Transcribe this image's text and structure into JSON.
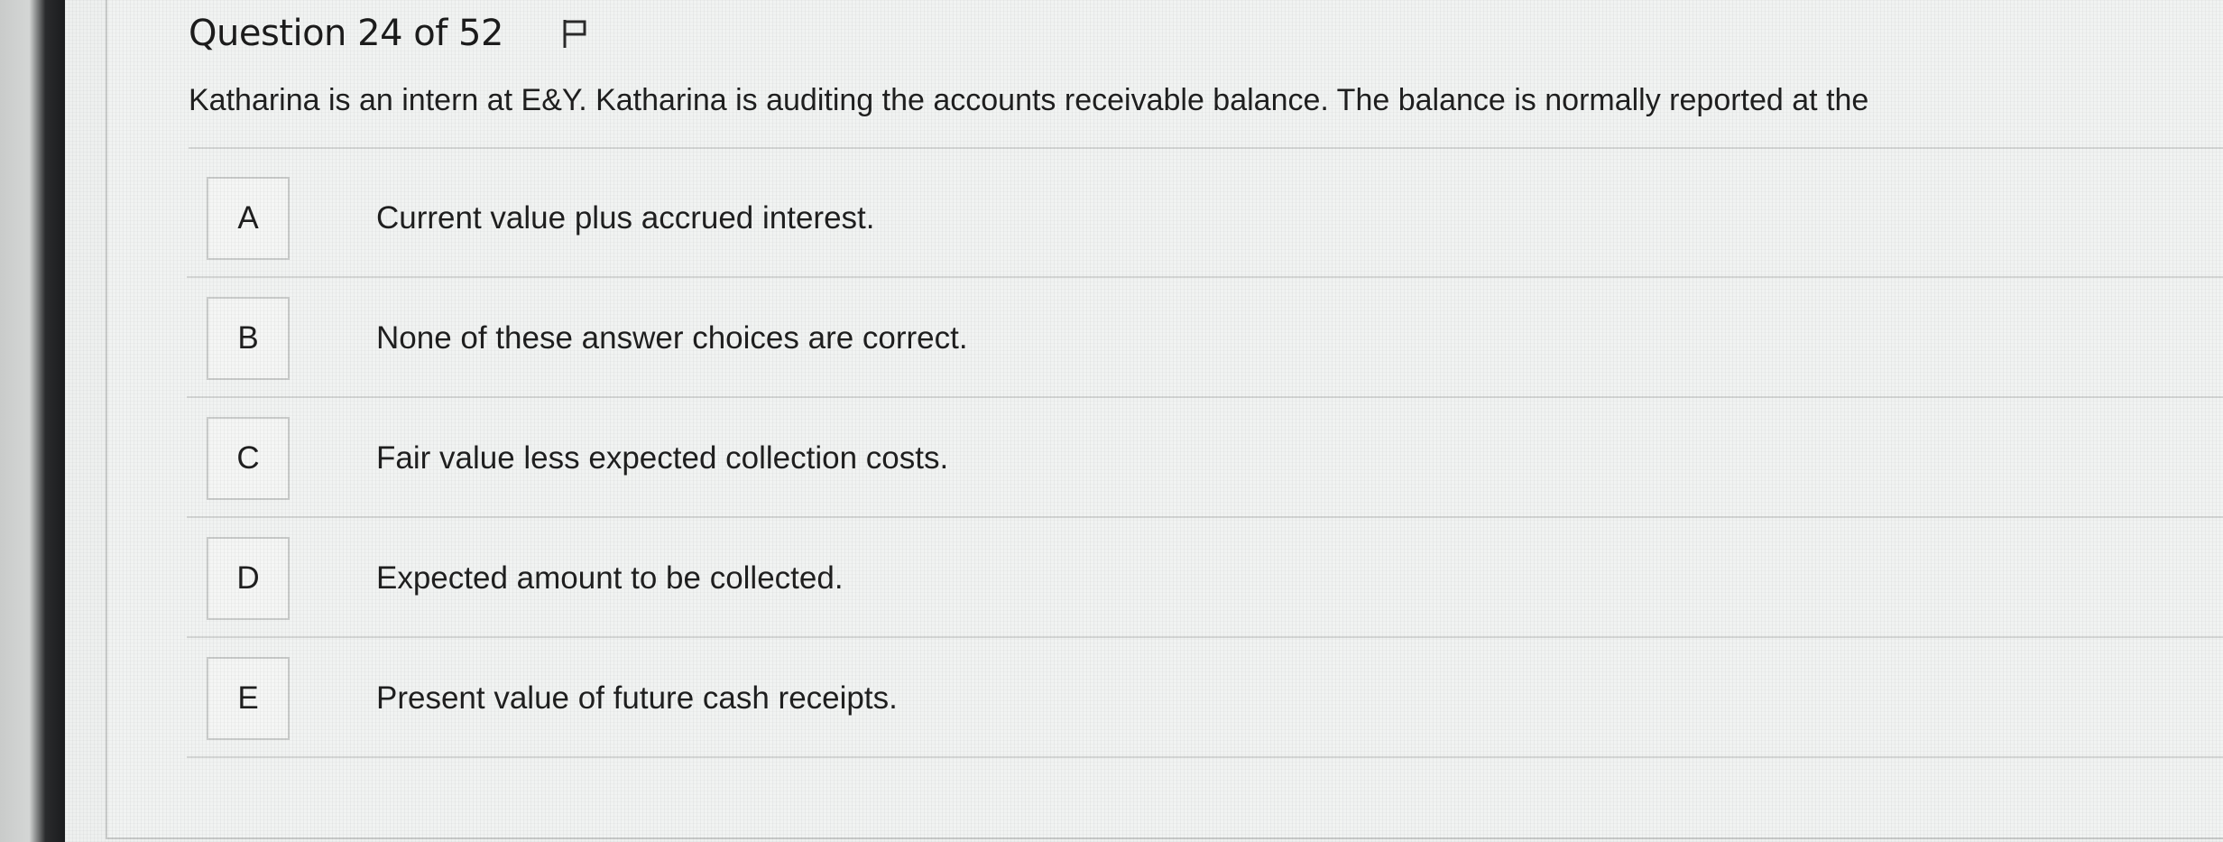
{
  "question": {
    "title": "Question 24 of 52",
    "flag_icon": "flag-icon",
    "stem": "Katharina is an intern at E&Y. Katharina is auditing the accounts receivable balance. The balance is normally reported at the"
  },
  "options": [
    {
      "letter": "A",
      "text": "Current value plus accrued interest."
    },
    {
      "letter": "B",
      "text": "None of these answer choices are correct."
    },
    {
      "letter": "C",
      "text": "Fair value less expected collection costs."
    },
    {
      "letter": "D",
      "text": "Expected amount to be collected."
    },
    {
      "letter": "E",
      "text": "Present value of future cash receipts."
    }
  ],
  "colors": {
    "background": "#eef0ef",
    "divider": "#d3d5d4",
    "text": "#1f1f1f"
  }
}
